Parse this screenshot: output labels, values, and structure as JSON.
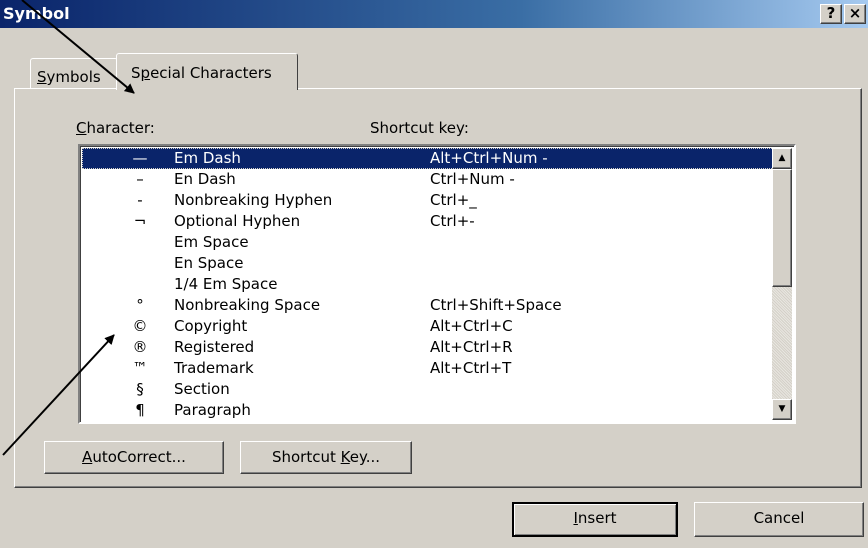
{
  "window": {
    "title": "Symbol",
    "help_button": "?",
    "close_button": "×"
  },
  "tabs": [
    {
      "label_accel": "S",
      "label_rest": "ymbols",
      "active": false
    },
    {
      "label_pre": "S",
      "label_accel": "p",
      "label_rest": "ecial Characters",
      "active": true
    }
  ],
  "list": {
    "header_character_accel": "C",
    "header_character_rest": "haracter:",
    "header_shortcut": "Shortcut key:",
    "rows": [
      {
        "glyph": "—",
        "name": "Em Dash",
        "shortcut": "Alt+Ctrl+Num -",
        "selected": true
      },
      {
        "glyph": "–",
        "name": "En Dash",
        "shortcut": "Ctrl+Num -"
      },
      {
        "glyph": "-",
        "name": "Nonbreaking Hyphen",
        "shortcut": "Ctrl+_"
      },
      {
        "glyph": "¬",
        "name": "Optional Hyphen",
        "shortcut": "Ctrl+-"
      },
      {
        "glyph": "",
        "name": "Em Space",
        "shortcut": ""
      },
      {
        "glyph": "",
        "name": "En Space",
        "shortcut": ""
      },
      {
        "glyph": "",
        "name": "1/4 Em Space",
        "shortcut": ""
      },
      {
        "glyph": "°",
        "name": "Nonbreaking Space",
        "shortcut": "Ctrl+Shift+Space"
      },
      {
        "glyph": "©",
        "name": "Copyright",
        "shortcut": "Alt+Ctrl+C"
      },
      {
        "glyph": "®",
        "name": "Registered",
        "shortcut": "Alt+Ctrl+R"
      },
      {
        "glyph": "™",
        "name": "Trademark",
        "shortcut": "Alt+Ctrl+T"
      },
      {
        "glyph": "§",
        "name": "Section",
        "shortcut": ""
      },
      {
        "glyph": "¶",
        "name": "Paragraph",
        "shortcut": ""
      }
    ],
    "scroll_up_icon": "▲",
    "scroll_down_icon": "▼"
  },
  "buttons": {
    "autocorrect_accel": "A",
    "autocorrect_rest": "utoCorrect...",
    "shortcut_pre": "Shortcut ",
    "shortcut_accel": "K",
    "shortcut_rest": "ey...",
    "insert_accel": "I",
    "insert_rest": "nsert",
    "cancel": "Cancel"
  },
  "colors": {
    "selection": "#0a246a",
    "dialog_face": "#d4d0c8"
  }
}
